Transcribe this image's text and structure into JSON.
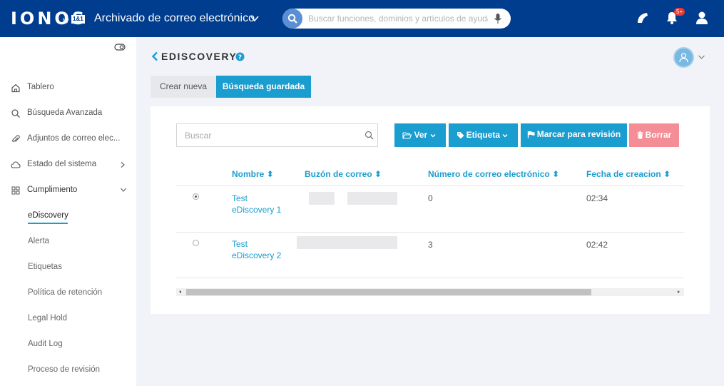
{
  "topbar": {
    "logo": "IONOS",
    "logo_by": "by",
    "logo_brand": "1&1",
    "app_title": "Archivado de correo electrónico",
    "search_placeholder": "Buscar funciones, dominios y artículos de ayuda",
    "notifications_badge": "5+"
  },
  "sidebar": {
    "items": [
      {
        "label": "Tablero",
        "icon": "home-icon"
      },
      {
        "label": "Búsqueda Avanzada",
        "icon": "search-icon"
      },
      {
        "label": "Adjuntos de correo elec...",
        "icon": "paperclip-icon"
      },
      {
        "label": "Estado del sistema",
        "icon": "cloud-icon"
      },
      {
        "label": "Cumplimiento",
        "icon": "grid-icon"
      }
    ],
    "subitems": [
      {
        "label": "eDiscovery"
      },
      {
        "label": "Alerta"
      },
      {
        "label": "Etiquetas"
      },
      {
        "label": "Política de retención"
      },
      {
        "label": "Legal Hold"
      },
      {
        "label": "Audit Log"
      },
      {
        "label": "Proceso de revisión"
      }
    ]
  },
  "main": {
    "title": "EDISCOVERY",
    "tabs": [
      {
        "label": "Crear nueva"
      },
      {
        "label": "Búsqueda guardada"
      }
    ],
    "search_placeholder": "Buscar",
    "buttons": {
      "ver": "Ver",
      "etiqueta": "Etiqueta",
      "marcar": "Marcar para revisión",
      "borrar": "Borrar"
    },
    "table": {
      "headers": [
        "Nombre",
        "Buzón de correo",
        "Número de correo electrónico",
        "Fecha de creacion"
      ],
      "rows": [
        {
          "name": "Test eDiscovery 1",
          "count": "0",
          "date": "02:34",
          "selected": true
        },
        {
          "name": "Test eDiscovery 2",
          "count": "3",
          "date": "02:42",
          "selected": false
        }
      ]
    }
  },
  "colors": {
    "topbar": "#003d8f",
    "accent": "#1a9dcf",
    "danger_button": "#f58d96"
  }
}
